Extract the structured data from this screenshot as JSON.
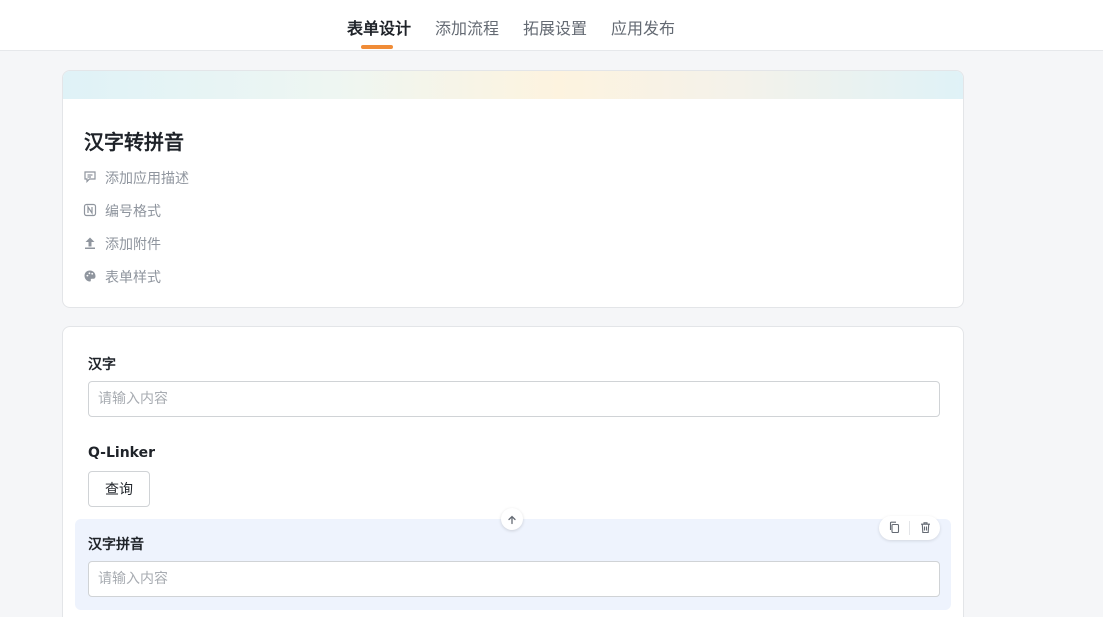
{
  "nav": {
    "tabs": [
      {
        "label": "表单设计",
        "active": true
      },
      {
        "label": "添加流程",
        "active": false
      },
      {
        "label": "拓展设置",
        "active": false
      },
      {
        "label": "应用发布",
        "active": false
      }
    ],
    "accent_color": "#f08c37"
  },
  "app": {
    "title": "汉字转拼音",
    "options": [
      {
        "label": "添加应用描述",
        "icon": "comment-icon"
      },
      {
        "label": "编号格式",
        "icon": "number-format-icon"
      },
      {
        "label": "添加附件",
        "icon": "upload-icon"
      },
      {
        "label": "表单样式",
        "icon": "palette-icon"
      }
    ]
  },
  "form": {
    "fields": [
      {
        "label": "汉字",
        "type": "input",
        "value": "",
        "placeholder": "请输入内容"
      },
      {
        "label": "Q-Linker",
        "type": "button",
        "button_label": "查询"
      },
      {
        "label": "汉字拼音",
        "type": "input",
        "value": "",
        "placeholder": "请输入内容",
        "selected": true
      }
    ],
    "selected_color": "#eef3fd"
  }
}
